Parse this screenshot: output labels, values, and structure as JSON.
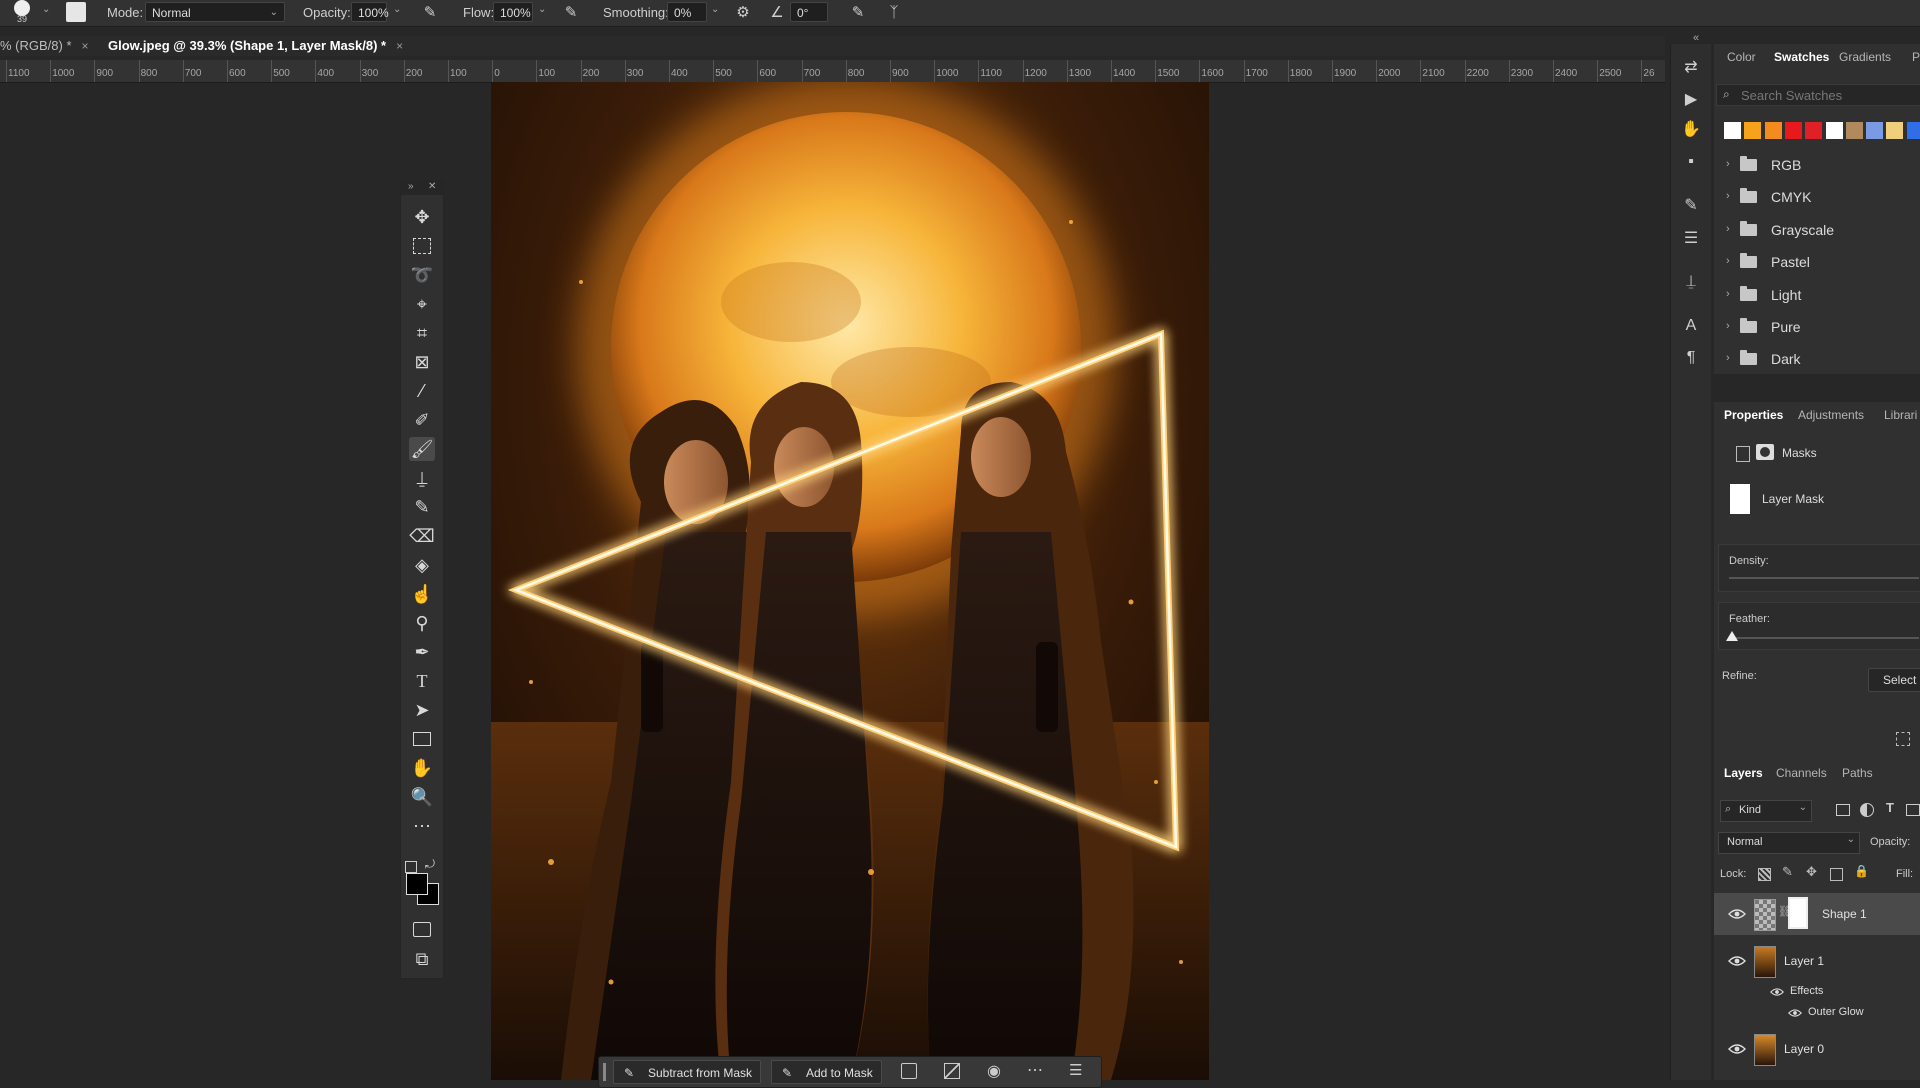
{
  "options_bar": {
    "brush_size": "39",
    "mode_label": "Mode:",
    "mode_value": "Normal",
    "opacity_label": "Opacity:",
    "opacity_value": "100%",
    "flow_label": "Flow:",
    "flow_value": "100%",
    "smoothing_label": "Smoothing:",
    "smoothing_value": "0%",
    "angle_value": "0°"
  },
  "tabs": [
    {
      "label": "% (RGB/8) *",
      "close": "×"
    },
    {
      "label": "Glow.jpeg @ 39.3% (Shape 1, Layer Mask/8) *",
      "close": "×"
    }
  ],
  "ruler": {
    "labels": [
      "1100",
      "1000",
      "900",
      "800",
      "700",
      "600",
      "500",
      "400",
      "300",
      "200",
      "100",
      "0",
      "100",
      "200",
      "300",
      "400",
      "500",
      "600",
      "700",
      "800",
      "900",
      "1000",
      "1100",
      "1200",
      "1300",
      "1400",
      "1500",
      "1600",
      "1700",
      "1800",
      "1900",
      "2000",
      "2100",
      "2200",
      "2300",
      "2400",
      "2500",
      "26"
    ]
  },
  "toolbox": {
    "tools": [
      "move-tool",
      "rectangular-marquee-tool",
      "lasso-tool",
      "quick-selection-tool",
      "crop-tool",
      "frame-tool",
      "eyedropper-tool",
      "healing-brush-tool",
      "brush-tool",
      "clone-stamp-tool",
      "history-brush-tool",
      "eraser-tool",
      "paint-bucket-tool",
      "smudge-tool",
      "dodge-tool",
      "pen-tool",
      "type-tool",
      "path-selection-tool",
      "rectangle-tool",
      "hand-tool",
      "zoom-tool",
      "more-tools"
    ],
    "selected": "brush-tool"
  },
  "swatches_panel": {
    "tabs": [
      "Color",
      "Swatches",
      "Gradients",
      "Pa"
    ],
    "active_tab": "Swatches",
    "search_placeholder": "Search Swatches",
    "swatch_colors": [
      "#ffffff",
      "#f7a21b",
      "#f58a1f",
      "#e8191c",
      "#e01f26",
      "#ffffff",
      "#b08a5c",
      "#7a9be3",
      "#f0cf7c",
      "#2f6ee6"
    ],
    "folders": [
      "RGB",
      "CMYK",
      "Grayscale",
      "Pastel",
      "Light",
      "Pure",
      "Dark"
    ]
  },
  "properties_panel": {
    "tabs": [
      "Properties",
      "Adjustments",
      "Librari"
    ],
    "active_tab": "Properties",
    "masks_label": "Masks",
    "layer_mask_label": "Layer Mask",
    "density_label": "Density:",
    "feather_label": "Feather:",
    "refine_label": "Refine:",
    "select_button": "Select"
  },
  "layers_panel": {
    "tabs": [
      "Layers",
      "Channels",
      "Paths"
    ],
    "active_tab": "Layers",
    "kind_label": "Kind",
    "blend_mode": "Normal",
    "opacity_label": "Opacity:",
    "lock_label": "Lock:",
    "fill_label": "Fill:",
    "layers": [
      {
        "name": "Shape 1",
        "visible": true,
        "selected": true
      },
      {
        "name": "Layer 1",
        "visible": true,
        "selected": false
      },
      {
        "name": "Layer 0",
        "visible": true,
        "selected": false
      }
    ],
    "effects_label": "Effects",
    "outer_glow_label": "Outer Glow"
  },
  "mask_bar": {
    "subtract_label": "Subtract from Mask",
    "add_label": "Add to Mask"
  },
  "colors": {
    "accent_glow": "#f6a623",
    "ui_bg": "#272727"
  }
}
